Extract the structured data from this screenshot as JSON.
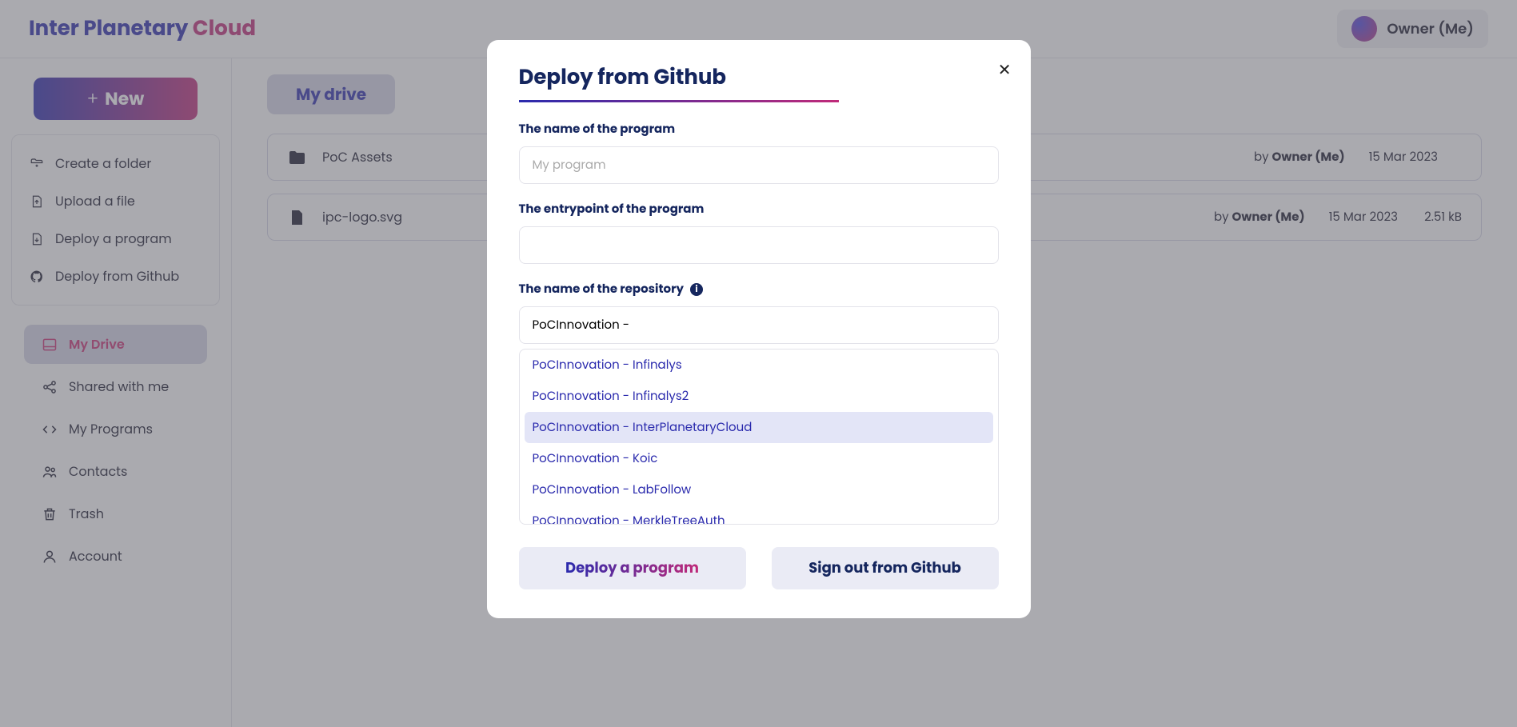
{
  "brand": {
    "part1": "Inter Planetary ",
    "part2": "Cloud"
  },
  "user": {
    "label": "Owner (Me)"
  },
  "new_button": {
    "label": "New"
  },
  "actions": {
    "create_folder": "Create a folder",
    "upload_file": "Upload a file",
    "deploy_program": "Deploy a program",
    "deploy_github": "Deploy from Github"
  },
  "nav": {
    "my_drive": "My Drive",
    "shared": "Shared with me",
    "programs": "My Programs",
    "contacts": "Contacts",
    "trash": "Trash",
    "account": "Account"
  },
  "breadcrumb": "My drive",
  "by_prefix": "by ",
  "rows": [
    {
      "name": "PoC Assets",
      "owner": "Owner (Me)",
      "date": "15 Mar 2023",
      "size": "",
      "is_folder": true
    },
    {
      "name": "ipc-logo.svg",
      "owner": "Owner (Me)",
      "date": "15 Mar 2023",
      "size": "2.51 kB",
      "is_folder": false
    }
  ],
  "modal": {
    "title": "Deploy from Github",
    "labels": {
      "program_name": "The name of the program",
      "entrypoint": "The entrypoint of the program",
      "repo": "The name of the repository"
    },
    "placeholders": {
      "program_name": "My program"
    },
    "values": {
      "program_name": "",
      "entrypoint": "",
      "repo_search": "PoCInnovation - "
    },
    "dropdown": [
      "PoCInnovation - Infinalys",
      "PoCInnovation - Infinalys2",
      "PoCInnovation - InterPlanetaryCloud",
      "PoCInnovation - Koic",
      "PoCInnovation - LabFollow",
      "PoCInnovation - MerkleTreeAuth"
    ],
    "highlight_index": 2,
    "buttons": {
      "deploy": "Deploy a program",
      "signout": "Sign out from Github"
    }
  }
}
